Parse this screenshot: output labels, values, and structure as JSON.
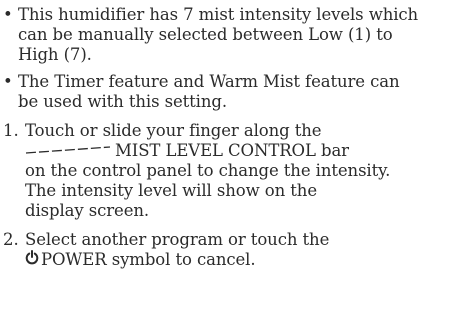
{
  "bullets": [
    {
      "marker": "•",
      "lines": [
        "This humidifier has 7 mist intensity levels which",
        "can be manually selected between Low (1) to",
        "High (7)."
      ]
    },
    {
      "marker": "•",
      "lines": [
        "The Timer feature and Warm Mist feature can",
        "be used with this setting."
      ]
    }
  ],
  "steps": [
    {
      "marker": "1.",
      "line1": "Touch or slide your finger along the",
      "line2_suffix": "MIST LEVEL CONTROL bar",
      "lines_rest": [
        "on the control panel to change the intensity.",
        "The intensity level will show on the",
        "display screen."
      ],
      "bar_icon": "mist-level-bar-icon"
    },
    {
      "marker": "2.",
      "line1": "Select another program or touch the",
      "line2_suffix": "POWER symbol to cancel.",
      "power_icon": "power-icon"
    }
  ],
  "colors": {
    "text": "#2b2b2b"
  }
}
